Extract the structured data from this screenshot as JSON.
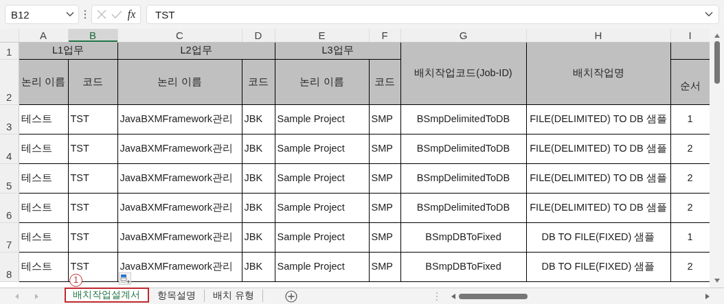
{
  "name_box": {
    "value": "B12"
  },
  "formula_bar": {
    "value": "TST",
    "function_label": "fx"
  },
  "columns": [
    {
      "label": "A",
      "selected": false
    },
    {
      "label": "B",
      "selected": true
    },
    {
      "label": "C",
      "selected": false
    },
    {
      "label": "D",
      "selected": false
    },
    {
      "label": "E",
      "selected": false
    },
    {
      "label": "F",
      "selected": false
    },
    {
      "label": "G",
      "selected": false
    },
    {
      "label": "H",
      "selected": false
    },
    {
      "label": "I",
      "selected": false
    }
  ],
  "header": {
    "groups": [
      "L1업무",
      "L2업무",
      "L3업무"
    ],
    "sub": [
      "논리 이름",
      "코드",
      "논리 이름",
      "코드",
      "논리 이름",
      "코드"
    ],
    "spanning": [
      "배치작업코드(Job-ID)",
      "배치작업명"
    ],
    "last": "순서"
  },
  "header_rows": [
    "1",
    "2"
  ],
  "rows": [
    {
      "label": "3",
      "cells": [
        "테스트",
        "TST",
        "JavaBXMFramework관리",
        "JBK",
        "Sample Project",
        "SMP",
        "BSmpDelimitedToDB",
        "FILE(DELIMITED) TO DB 샘플",
        "1"
      ]
    },
    {
      "label": "4",
      "cells": [
        "테스트",
        "TST",
        "JavaBXMFramework관리",
        "JBK",
        "Sample Project",
        "SMP",
        "BSmpDelimitedToDB",
        "FILE(DELIMITED) TO DB 샘플",
        "2"
      ]
    },
    {
      "label": "5",
      "cells": [
        "테스트",
        "TST",
        "JavaBXMFramework관리",
        "JBK",
        "Sample Project",
        "SMP",
        "BSmpDelimitedToDB",
        "FILE(DELIMITED) TO DB 샘플",
        "2"
      ]
    },
    {
      "label": "6",
      "cells": [
        "테스트",
        "TST",
        "JavaBXMFramework관리",
        "JBK",
        "Sample Project",
        "SMP",
        "BSmpDelimitedToDB",
        "FILE(DELIMITED) TO DB 샘플",
        "2"
      ]
    },
    {
      "label": "7",
      "cells": [
        "테스트",
        "TST",
        "JavaBXMFramework관리",
        "JBK",
        "Sample Project",
        "SMP",
        "BSmpDBToFixed",
        "DB TO FILE(FIXED) 샘플",
        "1"
      ]
    },
    {
      "label": "8",
      "cells": [
        "테스트",
        "TST",
        "JavaBXMFramework관리",
        "JBK",
        "Sample Project",
        "SMP",
        "BSmpDBToFixed",
        "DB TO FILE(FIXED) 샘플",
        "2"
      ]
    }
  ],
  "sheet_tabs": [
    {
      "label": "배치작업설계서",
      "selected": true,
      "annotated": true
    },
    {
      "label": "항목설명",
      "selected": false,
      "annotated": false
    },
    {
      "label": "배치 유형",
      "selected": false,
      "annotated": false
    }
  ],
  "annotation": {
    "label": "1"
  }
}
